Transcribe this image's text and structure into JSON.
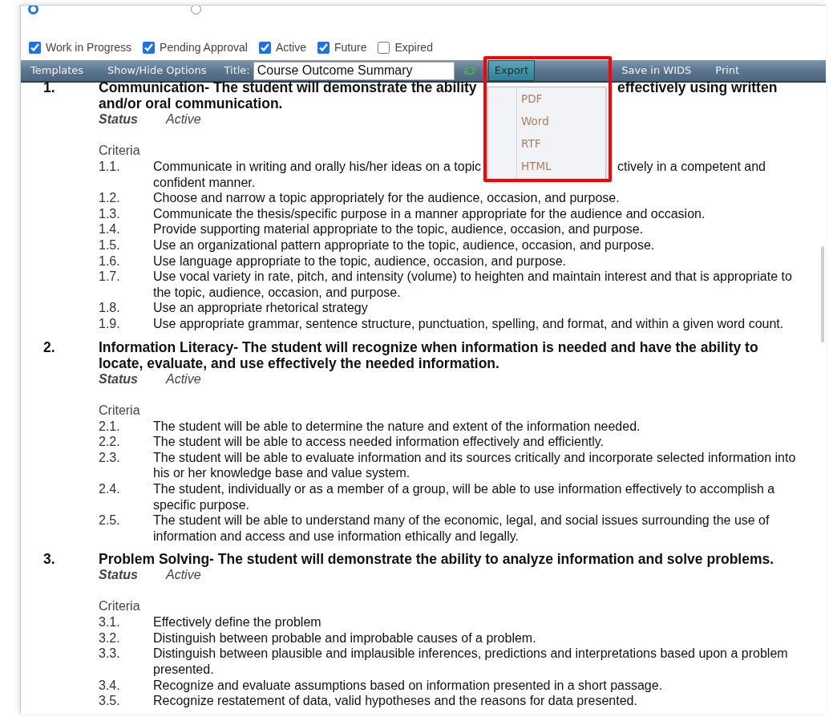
{
  "radios": [
    {
      "selected": true
    },
    {
      "selected": false
    }
  ],
  "filters": [
    {
      "label": "Work in Progress",
      "checked": true
    },
    {
      "label": "Pending Approval",
      "checked": true
    },
    {
      "label": "Active",
      "checked": true
    },
    {
      "label": "Future",
      "checked": true
    },
    {
      "label": "Expired",
      "checked": false
    }
  ],
  "toolbar": {
    "buttons": [
      "Templates",
      "Show/Hide Options"
    ],
    "title_label": "Title:",
    "title_value": "Course Outcome Summary",
    "menus": [
      {
        "label": "Export",
        "open": true
      },
      {
        "label": "Save in WIDS",
        "open": false
      },
      {
        "label": "Print",
        "open": false
      }
    ]
  },
  "export_menu": {
    "items": [
      "PDF",
      "Word",
      "RTF",
      "HTML"
    ]
  },
  "outcomes": [
    {
      "number": "1.",
      "title_lines": [
        [
          "Communication- The student will demonstrate the ability",
          "effectively using written"
        ],
        [
          "and/or oral communication."
        ]
      ],
      "status_label": "Status",
      "status": "Active",
      "criteria_label": "Criteria",
      "criteria": [
        {
          "number": "1.1.",
          "lines": [
            [
              "Communicate in writing and orally his/her ideas on a topic",
              "ctively in a competent and"
            ],
            [
              "confident manner."
            ]
          ]
        },
        {
          "number": "1.2.",
          "text": "Choose and narrow a topic appropriately for the audience, occasion, and purpose."
        },
        {
          "number": "1.3.",
          "text": "Communicate the thesis/specific purpose in a manner appropriate for the audience and occasion."
        },
        {
          "number": "1.4.",
          "text": "Provide supporting material appropriate to the topic, audience, occasion, and purpose."
        },
        {
          "number": "1.5.",
          "text": "Use an organizational pattern appropriate to the topic, audience, occasion, and purpose."
        },
        {
          "number": "1.6.",
          "text": "Use language appropriate to the topic, audience, occasion, and purpose."
        },
        {
          "number": "1.7.",
          "text": "Use vocal variety in rate, pitch, and intensity (volume) to heighten and maintain interest and that is appropriate to the topic, audience, occasion, and purpose."
        },
        {
          "number": "1.8.",
          "text": "Use an appropriate rhetorical strategy"
        },
        {
          "number": "1.9.",
          "text": "Use appropriate grammar, sentence structure, punctuation, spelling, and format, and within a given word count."
        }
      ]
    },
    {
      "number": "2.",
      "title": "Information Literacy- The student will recognize when information is needed and have the ability to locate, evaluate, and use effectively the needed information.",
      "status_label": "Status",
      "status": "Active",
      "criteria_label": "Criteria",
      "criteria": [
        {
          "number": "2.1.",
          "text": "The student will be able to determine the nature and extent of the information needed."
        },
        {
          "number": "2.2.",
          "text": "The student will be able to access needed information effectively and efficiently."
        },
        {
          "number": "2.3.",
          "text": "The student will be able to evaluate information and its sources critically and incorporate selected information into his or her knowledge base and value system."
        },
        {
          "number": "2.4.",
          "text": "The student, individually or as a member of a group, will be able to use information effectively to accomplish a specific purpose."
        },
        {
          "number": "2.5.",
          "text": "The student will be able to understand many of the economic, legal, and social issues surrounding the use of information and access and use information ethically and legally."
        }
      ]
    },
    {
      "number": "3.",
      "title": "Problem Solving- The student will demonstrate the ability to analyze information and solve problems.",
      "status_label": "Status",
      "status": "Active",
      "criteria_label": "Criteria",
      "criteria": [
        {
          "number": "3.1.",
          "text": "Effectively define the problem"
        },
        {
          "number": "3.2.",
          "text": "Distinguish between probable and improbable causes of a problem."
        },
        {
          "number": "3.3.",
          "text": "Distinguish between plausible and implausible inferences, predictions and interpretations based upon a problem presented."
        },
        {
          "number": "3.4.",
          "text": "Recognize and evaluate assumptions based on information presented in a short passage."
        },
        {
          "number": "3.5.",
          "text": "Recognize restatement of data, valid hypotheses and the reasons for data presented."
        }
      ]
    }
  ]
}
